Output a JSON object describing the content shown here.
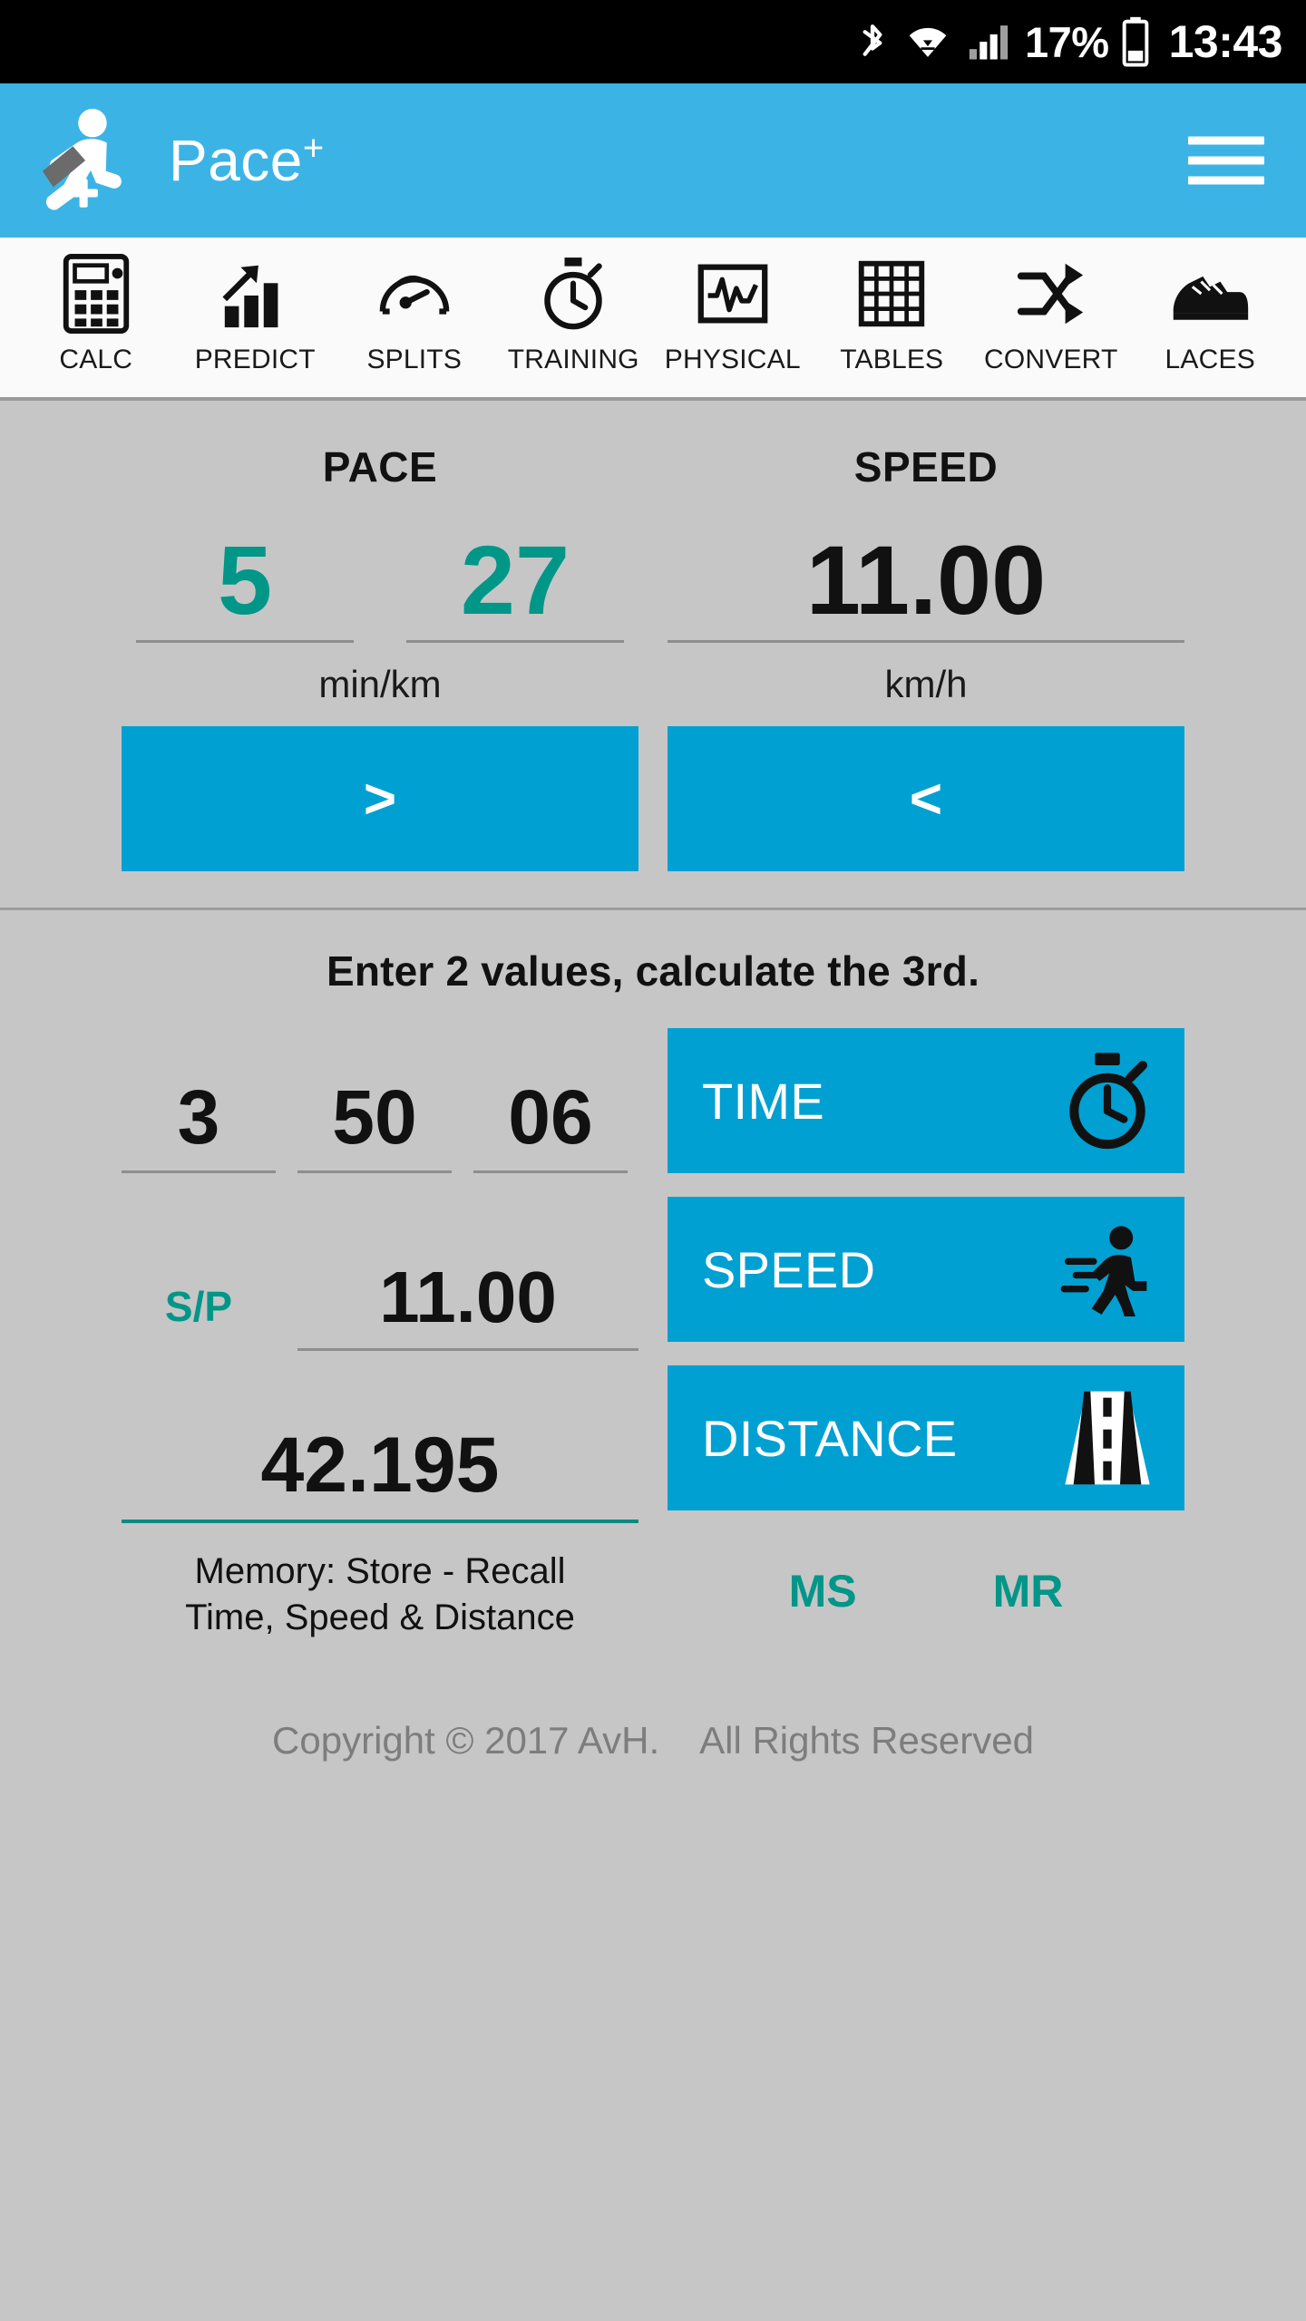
{
  "statusbar": {
    "bluetooth_icon": "bluetooth-icon",
    "wifi_icon": "wifi-icon",
    "signal_icon": "cellular-signal-icon",
    "battery_percent": "17%",
    "battery_icon": "battery-icon",
    "clock": "13:43"
  },
  "appbar": {
    "logo_icon": "running-man-logo-icon",
    "title": "Pace",
    "title_sup": "+",
    "menu_icon": "hamburger-menu-icon"
  },
  "tabs": [
    {
      "label": "CALC",
      "icon": "calculator-icon"
    },
    {
      "label": "PREDICT",
      "icon": "bar-chart-arrow-icon"
    },
    {
      "label": "SPLITS",
      "icon": "speedometer-icon"
    },
    {
      "label": "TRAINING",
      "icon": "stopwatch-icon"
    },
    {
      "label": "PHYSICAL",
      "icon": "heartbeat-monitor-icon"
    },
    {
      "label": "TABLES",
      "icon": "grid-table-icon"
    },
    {
      "label": "CONVERT",
      "icon": "shuffle-arrows-icon"
    },
    {
      "label": "LACES",
      "icon": "running-shoe-icon"
    }
  ],
  "converter": {
    "pace": {
      "heading": "PACE",
      "minutes": "5",
      "seconds": "27",
      "unit": "min/km",
      "button_label": ">"
    },
    "speed": {
      "heading": "SPEED",
      "value": "11.00",
      "unit": "km/h",
      "button_label": "<"
    }
  },
  "calculator": {
    "hint": "Enter 2 values, calculate the 3rd.",
    "time": {
      "hours": "3",
      "minutes": "50",
      "seconds": "06",
      "button_label": "TIME",
      "button_icon": "stopwatch-icon"
    },
    "speed": {
      "mode_label": "S/P",
      "value": "11.00",
      "button_label": "SPEED",
      "button_icon": "running-man-icon"
    },
    "distance": {
      "value": "42.195",
      "button_label": "DISTANCE",
      "button_icon": "road-icon"
    },
    "memory": {
      "line1": "Memory: Store - Recall",
      "line2": "Time, Speed & Distance",
      "store_label": "MS",
      "recall_label": "MR"
    }
  },
  "footer": {
    "copyright": "Copyright © 2017 AvH.",
    "rights": "All Rights Reserved"
  },
  "colors": {
    "accent_blue": "#3bb4e5",
    "button_blue": "#00a0d2",
    "teal": "#009688",
    "background": "#c6c6c6"
  }
}
